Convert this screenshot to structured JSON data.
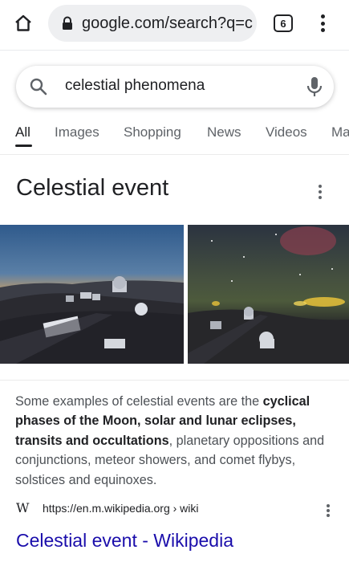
{
  "browser": {
    "url": "google.com/search?q=c",
    "tab_count": "6"
  },
  "search": {
    "query": "celestial phenomena"
  },
  "tabs": [
    {
      "label": "All"
    },
    {
      "label": "Images"
    },
    {
      "label": "Shopping"
    },
    {
      "label": "News"
    },
    {
      "label": "Videos"
    },
    {
      "label": "Ma"
    }
  ],
  "panel": {
    "title": "Celestial event",
    "images": [
      {
        "description": "observatory-at-dusk"
      },
      {
        "description": "observatory-night-sky"
      }
    ]
  },
  "snippet": {
    "part1": "Some examples of celestial events are the ",
    "bold": "cyclical phases of the Moon, solar and lunar eclipses, transits and occultations",
    "part2": ", planetary oppositions and conjunctions, meteor showers, and comet flybys, solstices and equinoxes."
  },
  "source": {
    "logo": "W",
    "url": "https://en.m.wikipedia.org › wiki"
  },
  "result": {
    "title": "Celestial event - Wikipedia"
  },
  "colors": {
    "link": "#1a0dab",
    "text": "#202124",
    "secondary": "#5f6368",
    "urlbar_bg": "#eeeff1"
  }
}
